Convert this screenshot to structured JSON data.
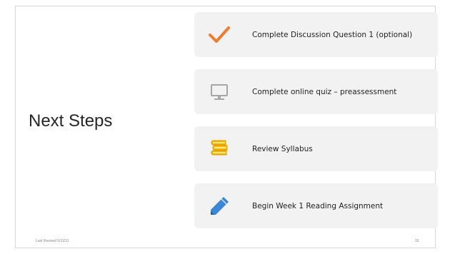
{
  "slide": {
    "title": "Next Steps",
    "items": [
      {
        "label": "Complete Discussion Question 1 (optional)",
        "icon": "checkmark-icon",
        "icon_color": "#ed7d31"
      },
      {
        "label": "Complete online quiz – preassessment",
        "icon": "monitor-icon",
        "icon_color": "#a6a6a6"
      },
      {
        "label": "Review Syllabus",
        "icon": "books-icon",
        "icon_color": "#f2b800"
      },
      {
        "label": "Begin Week 1 Reading Assignment",
        "icon": "pencil-icon",
        "icon_color": "#3b86d8"
      }
    ],
    "footer_left": "Last Revised 5/11/21",
    "page_number": "16"
  },
  "colors": {
    "card_background": "#f2f2f2",
    "title_text": "#262626",
    "footer_text": "#8a8a8a"
  }
}
